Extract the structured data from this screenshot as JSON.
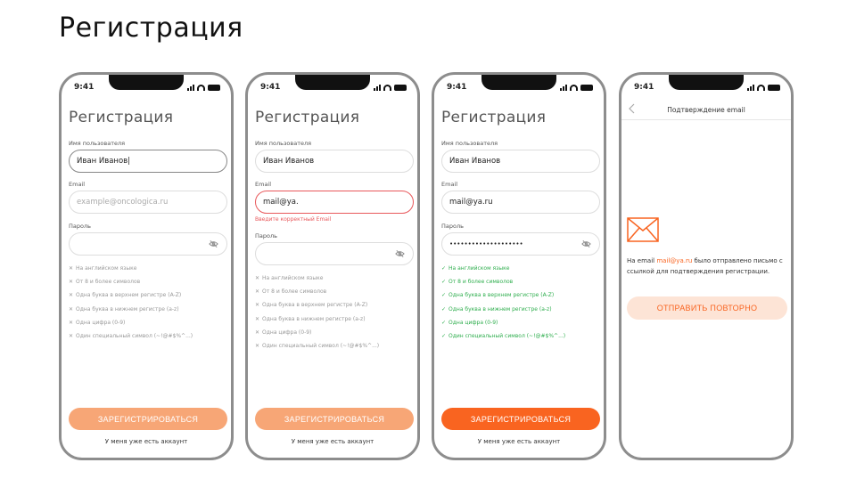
{
  "page_title": "Регистрация",
  "status": {
    "time": "9:41"
  },
  "form": {
    "title": "Регистрация",
    "username_label": "Имя пользователя",
    "email_label": "Email",
    "password_label": "Пароль",
    "email_placeholder": "example@oncologica.ru",
    "register_button": "ЗАРЕГИСТРИРОВАТЬСЯ",
    "login_link": "У меня уже есть аккаунт",
    "email_error": "Введите корректный Email"
  },
  "rules": [
    "На английском языке",
    "От 8 и более символов",
    "Одна буква в верхнем регистре (A-Z)",
    "Одна буква в нижнем регистре (a-z)",
    "Одна цифра (0-9)",
    "Один специальный символ (~!@#$%^...)"
  ],
  "icons": {
    "cross": "✕",
    "check": "✓"
  },
  "screens": {
    "s1": {
      "username_value": "Иван Иванов|"
    },
    "s2": {
      "username_value": "Иван Иванов",
      "email_value": "mail@ya."
    },
    "s3": {
      "username_value": "Иван Иванов",
      "email_value": "mail@ya.ru",
      "password_value": "••••••••••••••••••••"
    },
    "s4": {
      "back_icon": "chevron-left-icon",
      "header_title": "Подтверждение email",
      "text_prefix": "На email ",
      "email": "mail@ya.ru",
      "text_suffix": " было отправлено письмо с ссылкой для подтверждения регистрации.",
      "resend_button": "ОТПРАВИТЬ ПОВТОРНО"
    }
  },
  "colors": {
    "accent": "#f96420",
    "accent_light": "#f7a676",
    "error": "#e8585b",
    "success": "#2fae4e"
  }
}
